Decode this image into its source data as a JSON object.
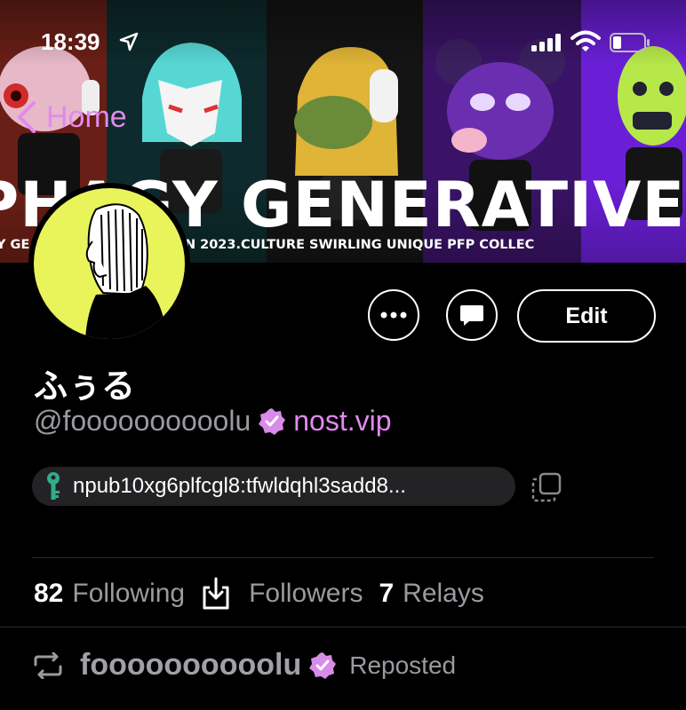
{
  "status_bar": {
    "time": "18:39"
  },
  "banner": {
    "title": "PHAGY GENERATIVE",
    "subtitle": "Y GE                    N TO BE LAUNCHED IN 2023.CULTURE SWIRLING UNIQUE PFP COLLEC"
  },
  "nav": {
    "back_label": "Home"
  },
  "profile": {
    "display_name": "ふぅる",
    "handle": "@foooooooooolu",
    "nip05": "nost.vip",
    "npub": "npub10xg6plfcgl8:tfwldqhl3sadd8..."
  },
  "actions": {
    "edit_label": "Edit"
  },
  "stats": {
    "following_count": "82",
    "following_label": "Following",
    "followers_label": "Followers",
    "relays_count": "7",
    "relays_label": "Relays"
  },
  "feed": {
    "repost_name": "foooooooooolu",
    "repost_label": "Reposted"
  },
  "colors": {
    "accent": "#e289ef",
    "avatar_bg": "#e8f45a"
  }
}
